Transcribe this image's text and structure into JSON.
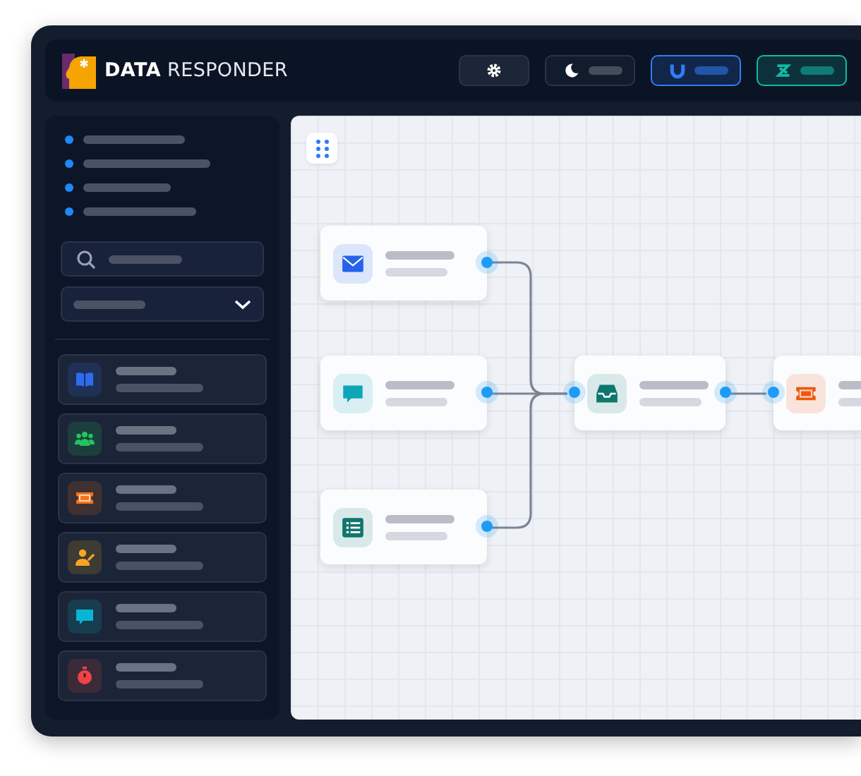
{
  "header": {
    "logo": "**DATA** RESPONDER",
    "buttons": [
      {
        "kind": "settings"
      },
      {
        "kind": "theme"
      },
      {
        "kind": "magnet",
        "color": "#2f7cf6"
      },
      {
        "kind": "zap",
        "color": "#14b8a6"
      }
    ]
  },
  "sidebar": {
    "cards": [
      {
        "kind": "book",
        "color": "#2f6bf0"
      },
      {
        "kind": "people",
        "color": "#22c55e"
      },
      {
        "kind": "ticket",
        "color": "#f97316"
      },
      {
        "kind": "person-edit",
        "color": "#f5a524"
      },
      {
        "kind": "chat",
        "color": "#06b6d4"
      },
      {
        "kind": "timer",
        "color": "#ef4444"
      }
    ]
  },
  "canvas": {
    "nodes": [
      {
        "kind": "mail",
        "color": "#2563eb"
      },
      {
        "kind": "chat",
        "color": "#0ea5b7"
      },
      {
        "kind": "list",
        "color": "#0f766e"
      },
      {
        "kind": "inbox",
        "color": "#0f766e"
      },
      {
        "kind": "ticket",
        "color": "#ea580c"
      }
    ]
  }
}
